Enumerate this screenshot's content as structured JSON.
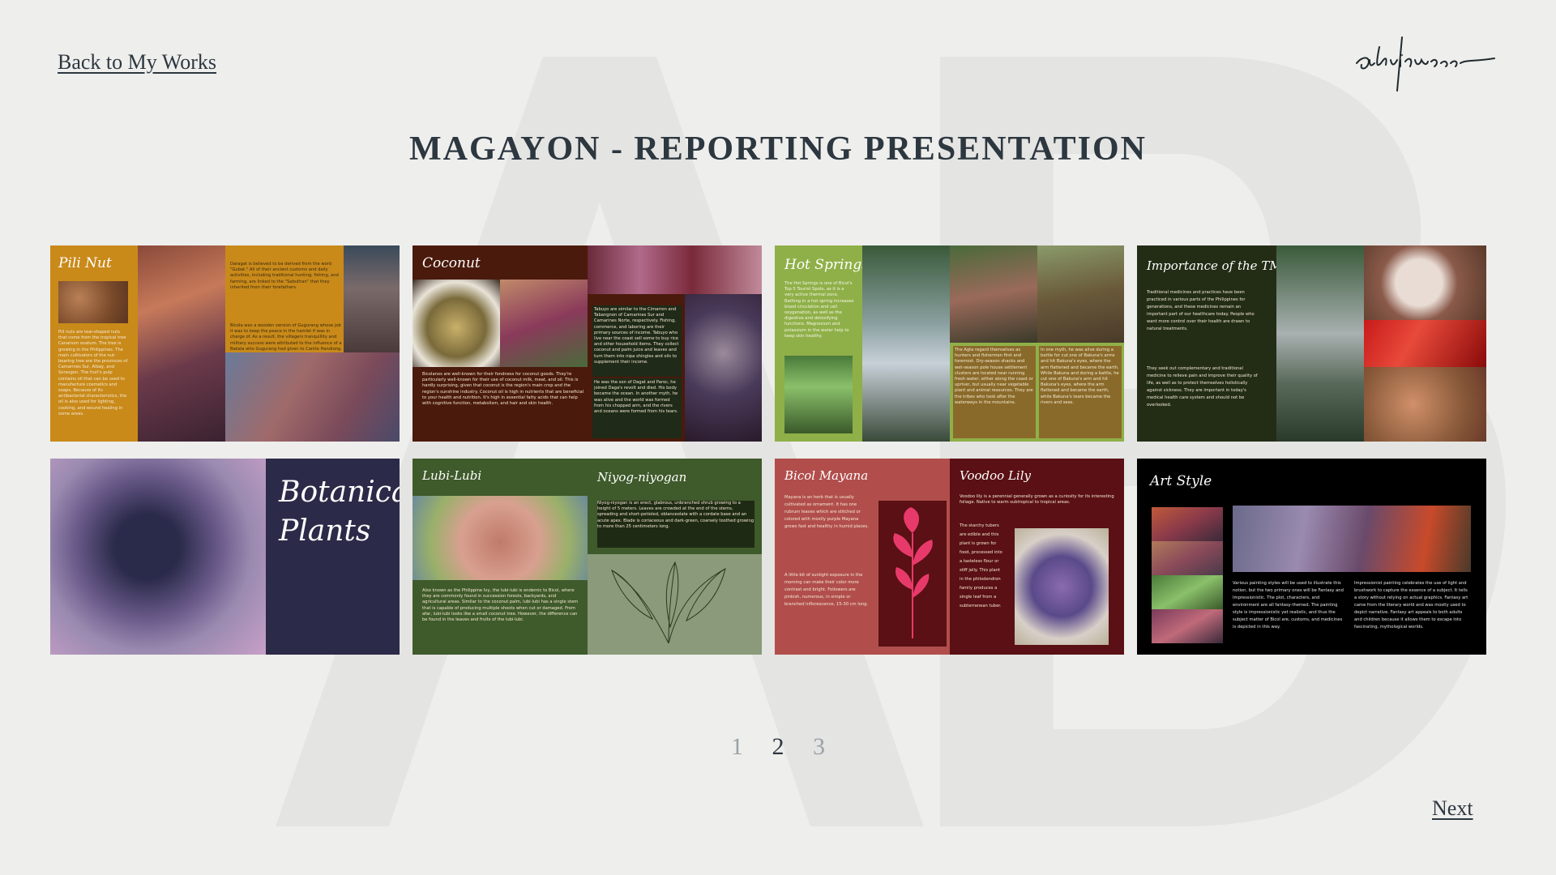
{
  "nav": {
    "back_label": "Back to My Works",
    "next_label": "Next"
  },
  "brand": {
    "logo_text": "adrianne"
  },
  "page": {
    "title": "MAGAYON - REPORTING PRESENTATION"
  },
  "slides": [
    {
      "title": "Pili Nut",
      "text_a": "Pili nuts are tear-shaped nuts that come from the tropical tree Canarium ovatum. The tree is growing in the Philippines. The main cultivators of the nut-bearing tree are the provinces of Camarines Sur, Albay, and Sorsogon. The fruit's pulp contains oil that can be used to manufacture cosmetics and soaps. Because of its antibacterial characteristics, the oil is also used for lighting, cooking, and wound healing in some areas.",
      "text_b": "Daragat is believed to be derived from the word \"Gubat.\" All of their ancient customs and daily activities, including traditional hunting, fishing, and farming, are linked to the \"Sabuthan\" that they inherited from their forefathers.",
      "text_c": "Bicola was a wooden version of Gugurang whose job it was to keep the peace in the hamlet if was in charge of. As a result, the villagers tranquillity and military success were attributed to the influence of a Bakala who Gugurang had given to Canito Handiong."
    },
    {
      "title": "Coconut",
      "text_a": "Bicolanos are well-known for their fondness for coconut goods. They're particularly well-known for their use of coconut milk, meat, and oil. This is hardly surprising, given that coconut is the region's main crop and the region's sunshine industry. Coconut oil is high in nutrients that are beneficial to your health and nutrition. It's high in essential fatty acids that can help with cognitive function, metabolism, and hair and skin health.",
      "text_b": "Tabuyo are similar to the Cimarron and Tabangnon of Camarines Sur and Camarines Norte, respectively. Fishing, commerce, and laboring are their primary sources of income. Tabuyo who live near the coast sell some to buy rice and other household items. They collect coconut and palm juice and leaves and turn them into nipa shingles and oils to supplement their income.",
      "text_c": "He was the son of Dagat and Paroc, he joined Daga's revolt and died. His body became the ocean. In another myth, he was alive and the world was formed from his chopped arm, and the rivers and oceans were formed from his tears."
    },
    {
      "title": "Hot Springs",
      "text_a": "The Hot Springs is one of Bicol's Top 5 Tourist Spots, as it is a very active thermal zone. Bathing in a hot spring increases blood circulation and cell oxygenation, as well as the digestive and detoxifying functions. Magnesium and potassium in the water help to keep skin healthy.",
      "text_b": "The Agta regard themselves as hunters and fishermen first and foremost. Dry-season shacks and wet-season pole house settlement clusters are located near running fresh water, either along the coast or upriver, but usually near vegetable plant and animal resources. They are the tribes who took after the waterways in the mountains.",
      "text_c": "In one myth, he was alive during a battle for cut one of Bakuna's arms and hit Bakuna's eyes, where the arm flattened and became the earth. While Bakuna and during a battle, he cut one of Bakuna's arm and hit Bakuna's eyes, where the arm flattened and became the earth, while Bakuna's tears became the rivers and seas."
    },
    {
      "title": "Importance of the TMPs",
      "text_a": "Traditional medicines and practices have been practiced in various parts of the Philippines for generations, and these medicines remain an important part of our healthcare today. People who want more control over their health are drawn to natural treatments.",
      "text_b": "They seek out complementary and traditional medicine to relieve pain and improve their quality of life, as well as to protect themselves holistically against sickness. They are important in today's medical health care system and should not be overlooked.",
      "text_c": ""
    },
    {
      "title": "Botanical Plants",
      "text_a": "",
      "text_b": "",
      "text_c": ""
    },
    {
      "title": "Lubi-Lubi",
      "title_b": "Niyog-niyogan",
      "text_a": "Also known as the Philippine Ivy, the lubi-lubi is endemic to Bicol, where they are commonly found in succession forests, backyards, and agricultural areas. Similar to the coconut palm, lubi-lubi has a single stem that is capable of producing multiple shoots when cut or damaged. From afar, lubi-lubi looks like a small coconut tree. However, the difference can be found in the leaves and fruits of the lubi-lubi.",
      "text_b": "Niyog-niyogan is an erect, glabrous, unbranched shrub growing to a height of 5 meters. Leaves are crowded at the end of the stems, spreading and short-petioled, oblanceolate with a cordate base and an acute apex. Blade is coriaceous and dark-green, coarsely toothed growing to more than 25 centimeters long.",
      "text_c": ""
    },
    {
      "title": "Bicol Mayana",
      "title_b": "Voodoo Lily",
      "text_a": "Mayana is an herb that is usually cultivated as ornament. It has one rubrum leaves which are stitched or colored with mostly purple Mayana grows fast and healthy in humid places.",
      "text_a2": "A little bit of sunlight exposure in the morning can make their color more contrast and bright. Followers are pinkish, numerous, in simple or branched inflorescence, 15-30 cm long.",
      "text_b": "Voodoo lily is a perennial generally grown as a curiosity for its interesting foliage. Native to warm subtropical to tropical areas.",
      "text_c": "The starchy tubers are edible and this plant is grown for food, processed into a tasteless flour or stiff jelly. This plant in the philodendron family produces a single leaf from a subterranean tuber."
    },
    {
      "title": "Art Style",
      "text_a": "Various painting styles will be used to illustrate this notion, but the two primary ones will be Fantasy and Impressionistic. The plot, characters, and environment are all fantasy-themed. The painting style is impressionistic yet realistic, and thus the subject matter of Bicol are, customs, and medicines is depicted in this way.",
      "text_b": "Impressionist painting celebrates the use of light and brushwork to capture the essence of a subject. It tells a story without relying on actual graphics. Fantasy art came from the literary world and was mostly used to depict narrative. Fantasy art appeals to both adults and children because it allows them to escape into fascinating, mythological worlds.",
      "text_c": ""
    }
  ],
  "pagination": {
    "pages": [
      "1",
      "2",
      "3"
    ],
    "current": "2"
  },
  "colors": {
    "background": "#eeeeec",
    "text": "#2c3740",
    "pili": "#c98a1a",
    "coconut": "#4a1a0c",
    "hotsprings": "#8fb048",
    "tmp": "#232d16",
    "botanical": "#2b2a48",
    "lubi": "#3f5a2b",
    "mayana": "#b14e4c",
    "artstyle": "#000000"
  }
}
